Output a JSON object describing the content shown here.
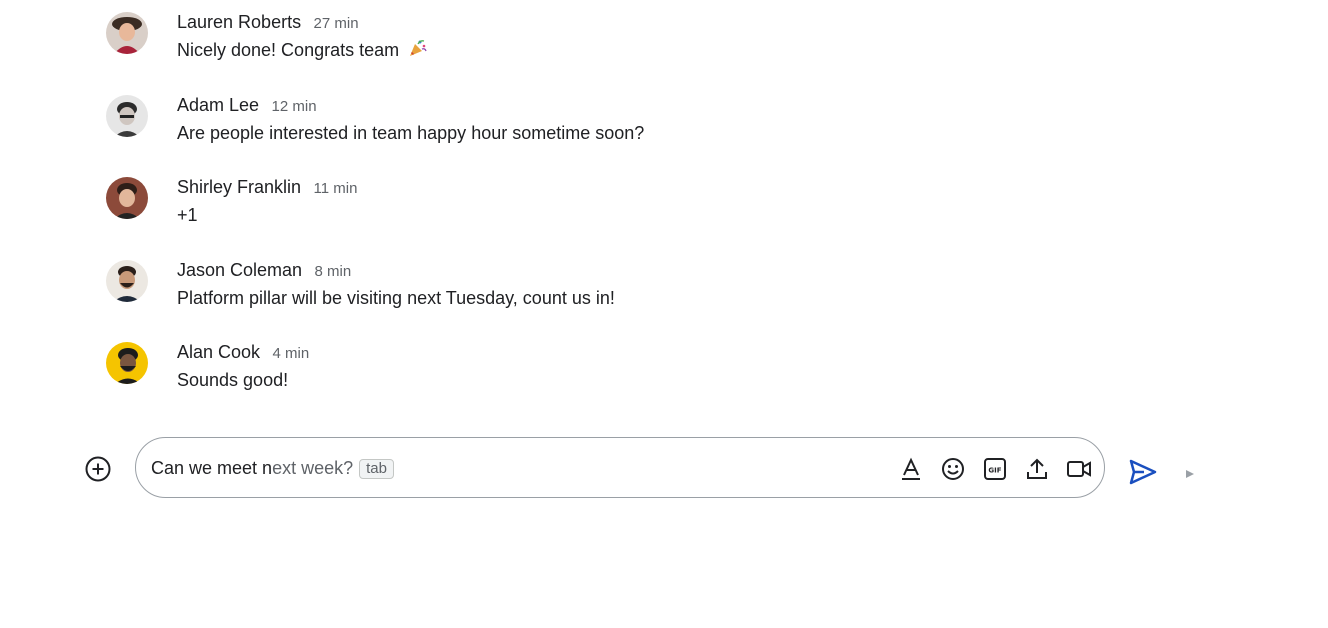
{
  "messages": [
    {
      "author": "Lauren Roberts",
      "time": "27 min",
      "text": "Nicely done!  Congrats team",
      "avatar": "lauren-avatar"
    },
    {
      "author": "Adam Lee",
      "time": "12 min",
      "text": "Are people interested in team happy hour sometime soon?",
      "avatar": "adam-avatar"
    },
    {
      "author": "Shirley Franklin",
      "time": "11 min",
      "text": "+1",
      "avatar": "shirley-avatar"
    },
    {
      "author": "Jason Coleman",
      "time": "8 min",
      "text": "Platform pillar will be visiting next Tuesday, count us in!",
      "avatar": "jason-avatar"
    },
    {
      "author": "Alan Cook",
      "time": "4 min",
      "text": "Sounds good!",
      "avatar": "alan-avatar"
    }
  ],
  "composer": {
    "typed_text": "Can we meet n",
    "suggestion_text": "ext week?",
    "tab_hint": "tab"
  },
  "colors": {
    "send_accent": "#1a4fbf",
    "border": "#9aa0a6",
    "muted_text": "#5f6368",
    "avatar_yellow": "#f5c400"
  },
  "icons": [
    "add-circle-icon",
    "text-format-icon",
    "emoji-icon",
    "gif-icon",
    "upload-icon",
    "video-call-icon",
    "send-icon",
    "confetti-icon"
  ]
}
